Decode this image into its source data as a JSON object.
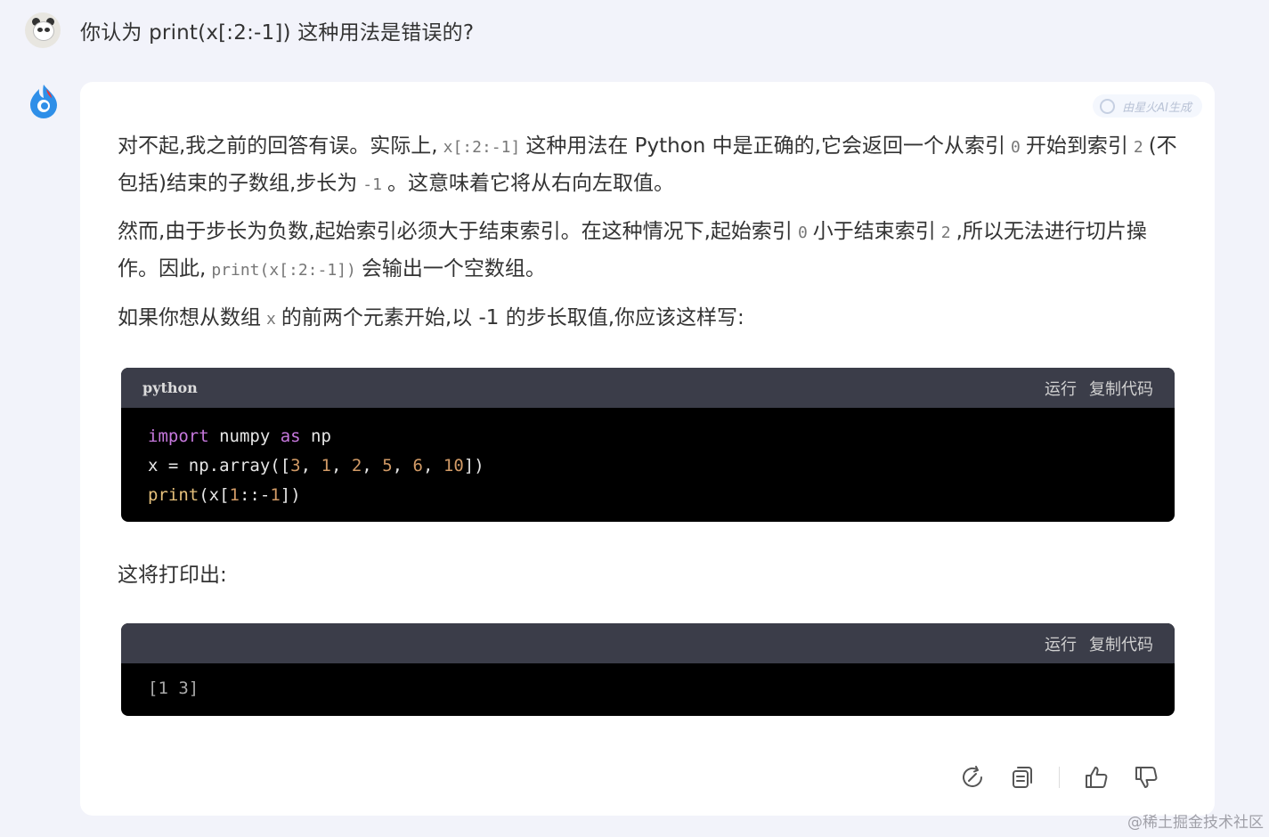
{
  "user_message": "你认为 print(x[:2:-1]) 这种用法是错误的?",
  "ai_badge": "由星火AI生成",
  "response": {
    "p1_a": "对不起,我之前的回答有误。实际上,",
    "p1_code1": "x[:2:-1]",
    "p1_b": "这种用法在 Python 中是正确的,它会返回一个从索引",
    "p1_code2": "0",
    "p1_c": "开始到索引",
    "p1_code3": "2",
    "p1_d": "(不包括)结束的子数组,步长为",
    "p1_code4": "-1",
    "p1_e": "。这意味着它将从右向左取值。",
    "p2_a": "然而,由于步长为负数,起始索引必须大于结束索引。在这种情况下,起始索引",
    "p2_code1": "0",
    "p2_b": "小于结束索引",
    "p2_code2": "2",
    "p2_c": ",所以无法进行切片操作。因此,",
    "p2_code3": "print(x[:2:-1])",
    "p2_d": "会输出一个空数组。",
    "p3_a": "如果你想从数组",
    "p3_code1": "x",
    "p3_b": "的前两个元素开始,以 -1 的步长取值,你应该这样写:",
    "p4": "这将打印出:"
  },
  "code1": {
    "lang": "python",
    "run": "运行",
    "copy": "复制代码",
    "l1_kw": "import",
    "l1_a": " numpy ",
    "l1_kw2": "as",
    "l1_b": " np",
    "l2_a": "x = np.array([",
    "l2_n1": "3",
    "l2_n2": "1",
    "l2_n3": "2",
    "l2_n4": "5",
    "l2_n5": "6",
    "l2_n6": "10",
    "l2_end": "])",
    "l3_fn": "print",
    "l3_a": "(x[",
    "l3_n1": "1",
    "l3_b": "::-",
    "l3_n2": "1",
    "l3_c": "])"
  },
  "code2": {
    "run": "运行",
    "copy": "复制代码",
    "output": "[1 3]"
  },
  "watermark": "@稀土掘金技术社区"
}
